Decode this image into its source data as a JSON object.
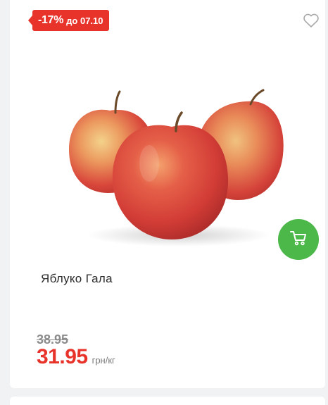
{
  "badge": {
    "percent": "-17%",
    "until": "до 07.10"
  },
  "product": {
    "title": "Яблуко Гала",
    "image_alt": "apples-image",
    "old_price": "38.95",
    "price": "31.95",
    "unit": "грн/кг"
  },
  "icons": {
    "favorite": "heart-icon",
    "cart": "cart-icon"
  },
  "colors": {
    "accent_red": "#e8332b",
    "cart_green": "#4cb84a"
  }
}
